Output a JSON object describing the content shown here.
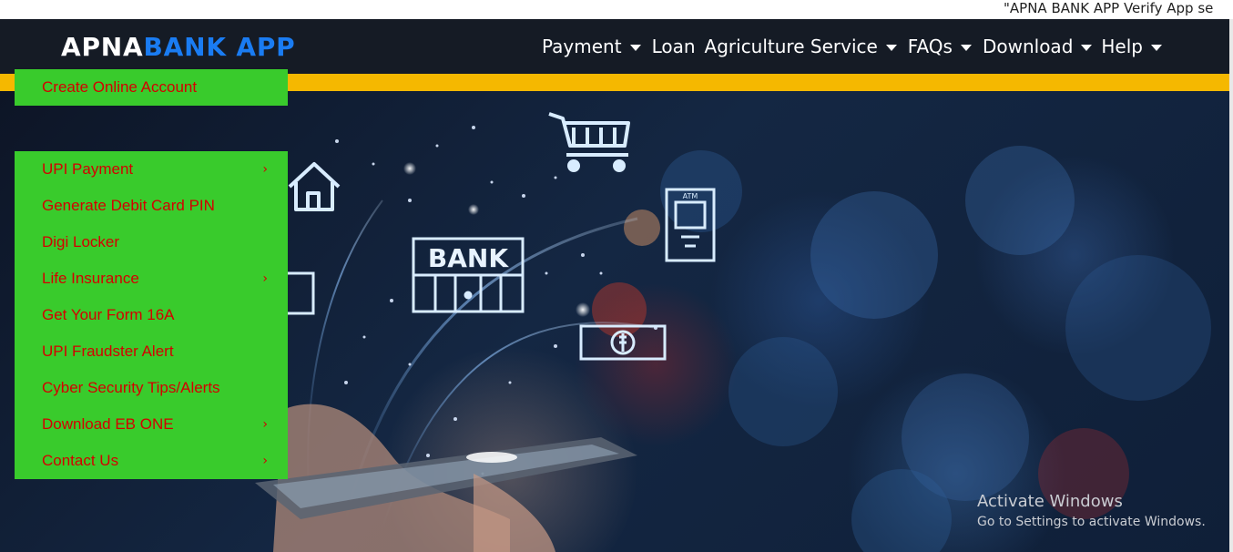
{
  "marquee": {
    "text": "\"APNA BANK APP Verify App se"
  },
  "header": {
    "logo_part1": "APNA",
    "logo_part2": "BANK APP",
    "nav": [
      {
        "label": "Payment",
        "has_dropdown": true
      },
      {
        "label": "Loan",
        "has_dropdown": false
      },
      {
        "label": "Agriculture Service",
        "has_dropdown": true
      },
      {
        "label": "FAQs",
        "has_dropdown": true
      },
      {
        "label": "Download",
        "has_dropdown": true
      },
      {
        "label": "Help",
        "has_dropdown": true
      }
    ]
  },
  "menu_top": {
    "items": [
      {
        "label": "Create Online Account"
      }
    ]
  },
  "menu_main": {
    "items": [
      {
        "label": "UPI Payment",
        "arrow": "›"
      },
      {
        "label": "Generate Debit Card PIN"
      },
      {
        "label": "Digi Locker"
      },
      {
        "label": "Life Insurance",
        "arrow": "›"
      },
      {
        "label": "Get Your Form 16A"
      },
      {
        "label": "UPI Fraudster Alert"
      },
      {
        "label": "Cyber Security Tips/Alerts"
      },
      {
        "label": "Download EB ONE",
        "arrow": "›"
      },
      {
        "label": "Contact Us",
        "arrow": "›"
      }
    ]
  },
  "hero": {
    "bank_sign": "BANK",
    "atm_sign": "ATM"
  },
  "watermark": {
    "title": "Activate Windows",
    "subtitle": "Go to Settings to activate Windows."
  },
  "colors": {
    "header_bg": "#151b25",
    "accent_blue": "#1a7cf2",
    "stripe_yellow": "#f5b800",
    "menu_green": "#39cb2c",
    "menu_text_red": "#d40000"
  }
}
